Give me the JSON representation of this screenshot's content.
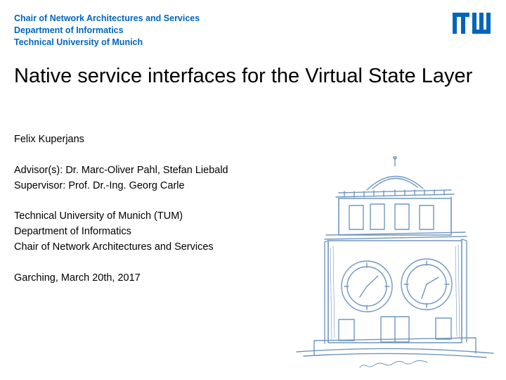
{
  "header": {
    "line1": "Chair of Network Architectures and Services",
    "line2": "Department of Informatics",
    "line3": "Technical University of Munich"
  },
  "title": "Native service interfaces for the Virtual State Layer",
  "author": "Felix Kuperjans",
  "advisors": "Advisor(s): Dr. Marc-Oliver Pahl, Stefan Liebald",
  "supervisor": "Supervisor: Prof. Dr.-Ing. Georg Carle",
  "affiliation": {
    "university": "Technical University of Munich (TUM)",
    "department": "Department of Informatics",
    "chair": "Chair of Network Architectures and Services"
  },
  "place_date": "Garching, March 20th, 2017",
  "logo_color": "#0065bd",
  "sketch_color": "#3a6ea8"
}
